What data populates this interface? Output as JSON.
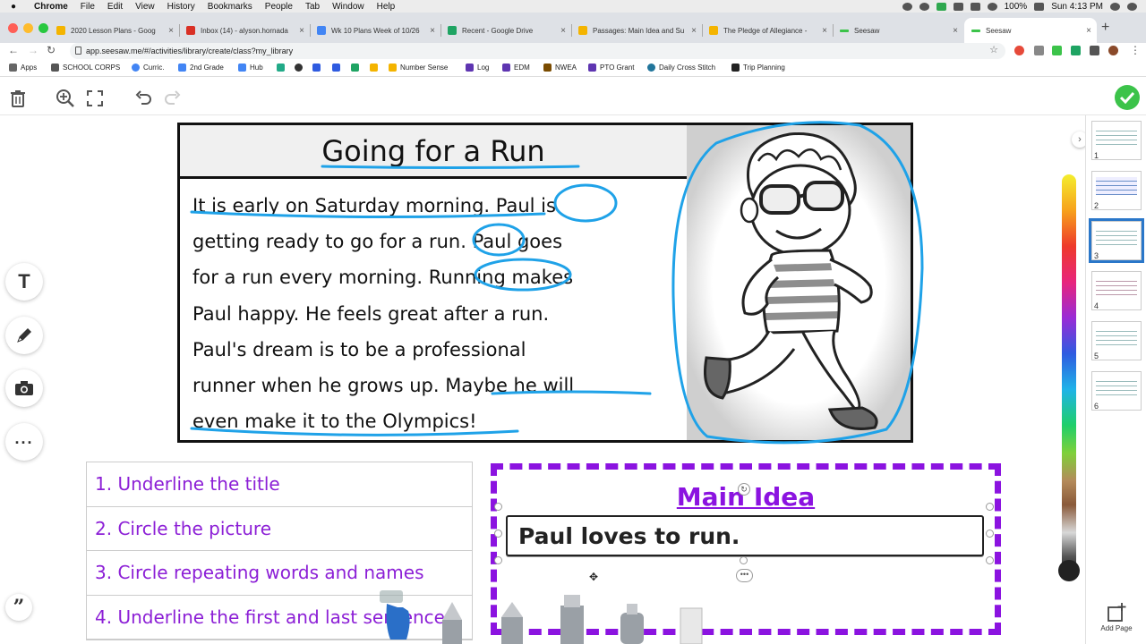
{
  "menubar": {
    "app": "Chrome",
    "items": [
      "File",
      "Edit",
      "View",
      "History",
      "Bookmarks",
      "People",
      "Tab",
      "Window",
      "Help"
    ],
    "battery": "100%",
    "clock": "Sun 4:13 PM"
  },
  "tabs": [
    {
      "title": "2020 Lesson Plans - Goog",
      "color": "#f4b400"
    },
    {
      "title": "Inbox (14) - alyson.hornada",
      "color": "#d93025"
    },
    {
      "title": "Wk 10 Plans Week of 10/26",
      "color": "#4285f4"
    },
    {
      "title": "Recent - Google Drive",
      "color": "#1fa463"
    },
    {
      "title": "Passages: Main Idea and Su",
      "color": "#f4b400"
    },
    {
      "title": "The Pledge of Allegiance -",
      "color": "#f4b400"
    },
    {
      "title": "Seesaw",
      "color": "#3cc34a"
    },
    {
      "title": "Seesaw",
      "color": "#3cc34a"
    }
  ],
  "address": {
    "url": "app.seesaw.me/#/activities/library/create/class?my_library"
  },
  "bookmarks": [
    {
      "label": "Apps",
      "color": "#666"
    },
    {
      "label": "SCHOOL CORPS",
      "color": "#555"
    },
    {
      "label": "Curric.",
      "color": "#4285f4"
    },
    {
      "label": "2nd Grade",
      "color": "#4285f4"
    },
    {
      "label": "Hub",
      "color": "#4285f4"
    },
    {
      "label": "",
      "color": "#2a8"
    },
    {
      "label": "",
      "color": "#333"
    },
    {
      "label": "",
      "color": "#2f5be0"
    },
    {
      "label": "",
      "color": "#2f5be0"
    },
    {
      "label": "",
      "color": "#1fa463"
    },
    {
      "label": "",
      "color": "#f4b400"
    },
    {
      "label": "Number Sense",
      "color": "#f4b400"
    },
    {
      "label": "Log",
      "color": "#5e35b1"
    },
    {
      "label": "EDM",
      "color": "#5e35b1"
    },
    {
      "label": "NWEA",
      "color": "#7a4b00"
    },
    {
      "label": "PTO Grant",
      "color": "#5e35b1"
    },
    {
      "label": "Daily Cross Stitch",
      "color": "#21759b"
    },
    {
      "label": "Trip Planning",
      "color": "#222"
    }
  ],
  "passage": {
    "title": "Going for a Run",
    "lines": [
      "It is early on Saturday morning.  Paul is",
      "getting ready to go for a run.  Paul goes",
      "for a run every morning.  Running makes",
      "Paul happy.  He feels great after a run.",
      "Paul's dream is to be a professional",
      "runner when he grows up.  Maybe he will",
      "even make it to the Olympics!"
    ]
  },
  "instructions": [
    "1. Underline the title",
    "2. Circle the picture",
    "3. Circle repeating words and names",
    "4. Underline the first and last sentence"
  ],
  "main_idea": {
    "title": "Main Idea",
    "answer": "Paul loves to run."
  },
  "pages": [
    "1",
    "2",
    "3",
    "4",
    "5",
    "6"
  ],
  "selected_page": "3",
  "add_page_label": "Add Page",
  "colors": {
    "ink_blue": "#1fa2e8",
    "purple": "#8b13e0",
    "check_green": "#3cc34a"
  }
}
